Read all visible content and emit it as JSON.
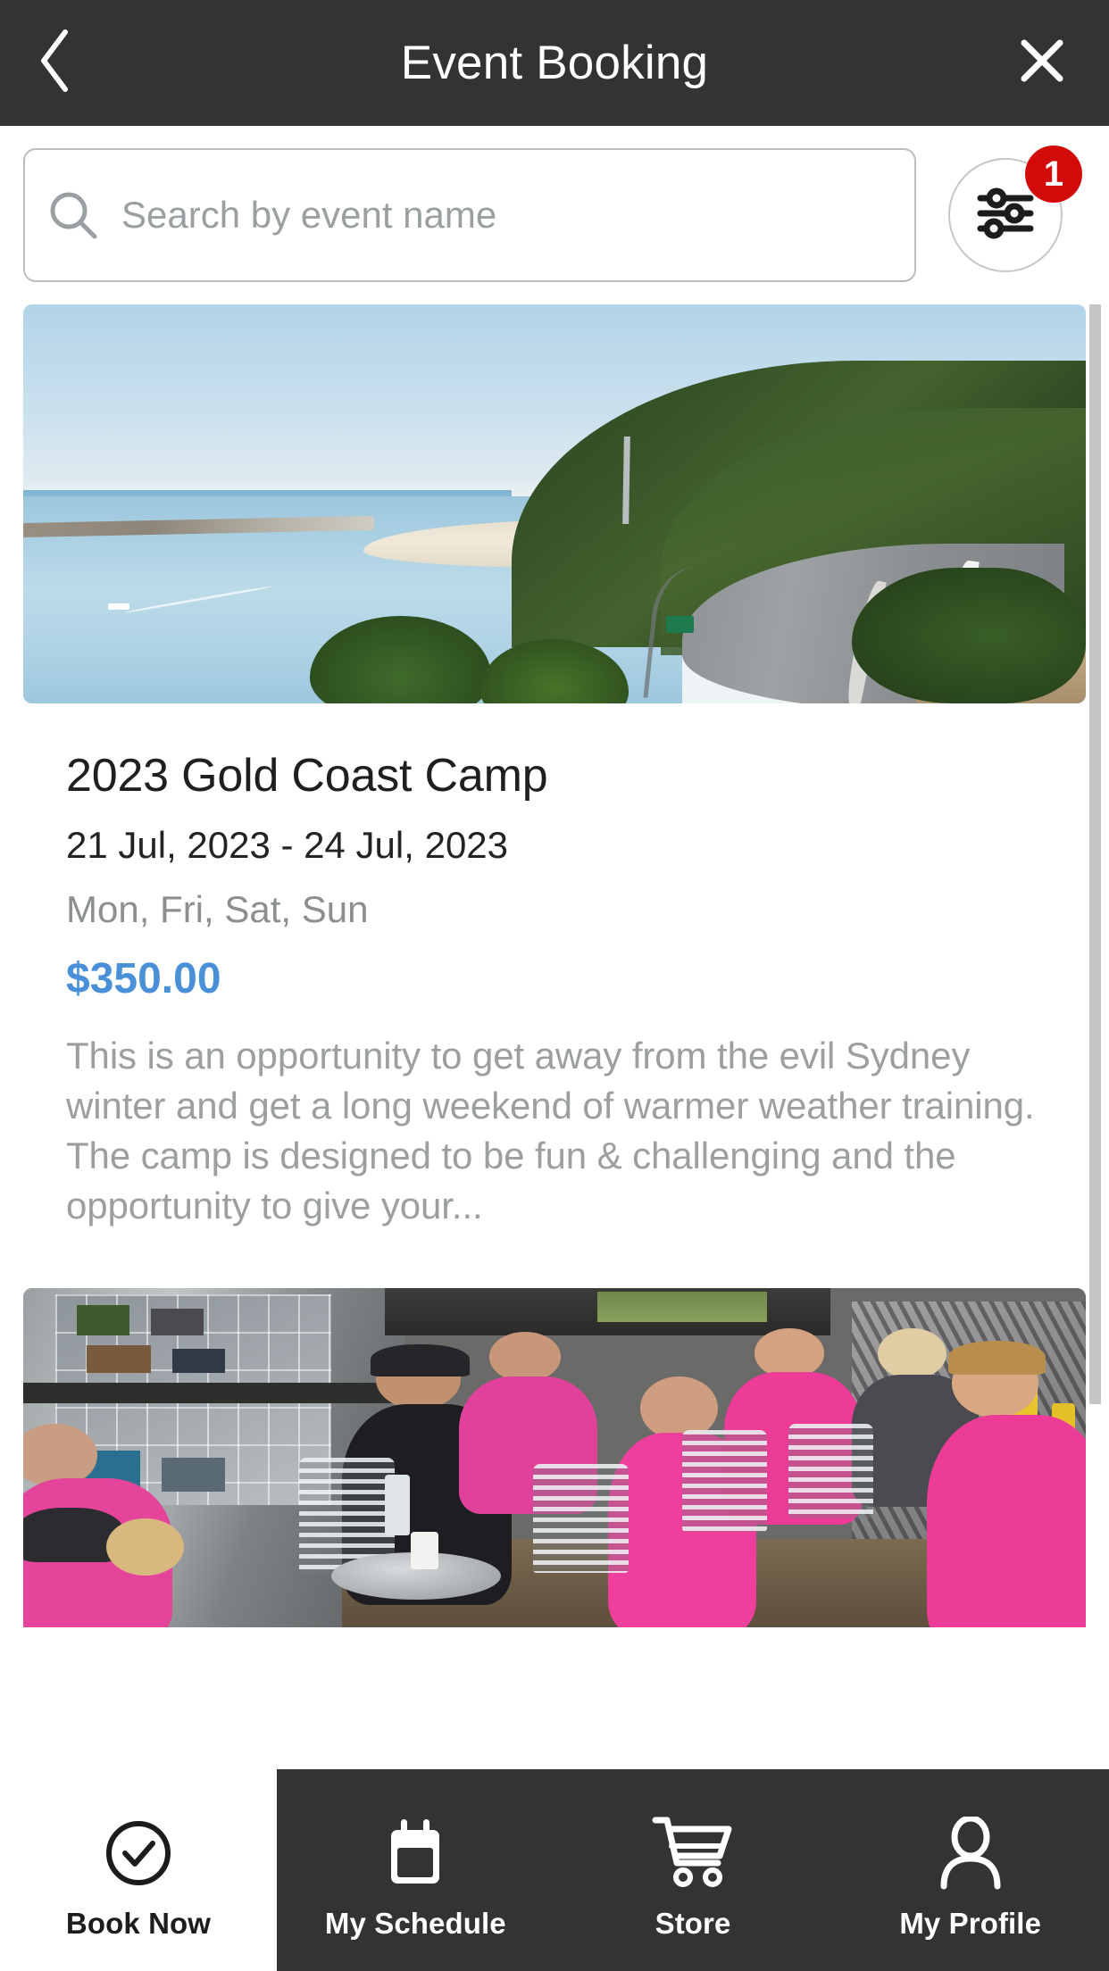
{
  "header": {
    "title": "Event Booking",
    "back_icon": "chevron-left-icon",
    "close_icon": "close-icon"
  },
  "search": {
    "placeholder": "Search by event name",
    "value": "",
    "icon": "search-icon",
    "filter_icon": "sliders-filter-icon",
    "filter_badge_count": "1",
    "badge_color": "#d20a0a"
  },
  "events": [
    {
      "title": "2023 Gold Coast Camp",
      "dates": "21 Jul, 2023 - 24 Jul, 2023",
      "days": "Mon, Fri, Sat, Sun",
      "price": "$350.00",
      "price_color": "#4a90d9",
      "description": "This is an opportunity to get away from the evil Sydney winter and get a long weekend of warmer weather training.   The camp is designed to be fun & challenging and the opportunity to give your...",
      "image_alt": "coastal-road-ocean-photo"
    },
    {
      "image_alt": "cyclists-group-cafe-photo"
    }
  ],
  "bottom_nav": {
    "items": [
      {
        "label": "Book Now",
        "icon": "check-circle-icon",
        "active": true
      },
      {
        "label": "My Schedule",
        "icon": "calendar-icon",
        "active": false
      },
      {
        "label": "Store",
        "icon": "shopping-cart-icon",
        "active": false
      },
      {
        "label": "My Profile",
        "icon": "person-icon",
        "active": false
      }
    ]
  },
  "scrollbar": {
    "name": "vertical-scrollbar",
    "thumb_color": "#c4c6c6"
  },
  "theme": {
    "header_bg": "#333333",
    "nav_bg": "#333333",
    "page_bg": "#ffffff"
  }
}
